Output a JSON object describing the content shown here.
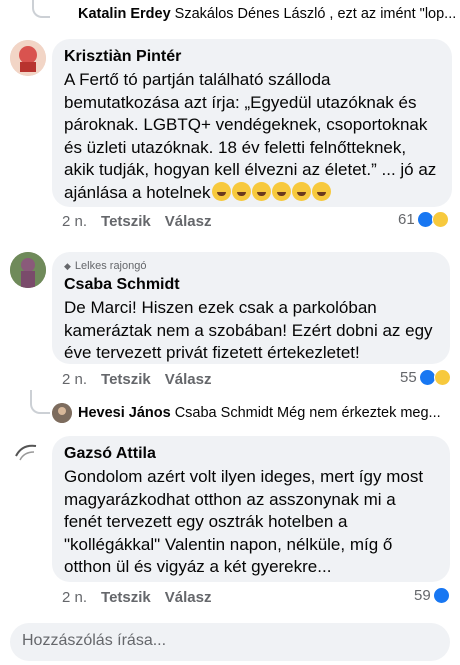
{
  "top_reply": {
    "author": "Katalin Erdey",
    "preview": "Szakálos Dénes László , ezt az imént \"lop..."
  },
  "comments": [
    {
      "author": "Krisztiàn Pintér",
      "text_before_emoji": "A Fertő tó partján található szálloda bemutatkozása azt írja: „Egyedül utazóknak és pároknak. LGBTQ+ vendégeknek, csoportoknak és üzleti utazóknak. 18 év feletti felnőtteknek, akik tudják, hogyan kell élvezni az életet.” ... jó az ajánlása a hotelnek",
      "emoji_count": 6,
      "time": "2 n.",
      "like_label": "Tetszik",
      "reply_label": "Válasz",
      "reaction_count": "61",
      "reaction_icons": [
        "like-icon",
        "haha-icon"
      ]
    },
    {
      "badge": "Lelkes rajongó",
      "author": "Csaba Schmidt",
      "text": "De Marci! Hiszen ezek csak a parkolóban kameráztak nem a szobában! Ezért dobni az egy éve tervezett privát fizetett értekezletet!",
      "time": "2 n.",
      "like_label": "Tetszik",
      "reply_label": "Válasz",
      "reaction_count": "55",
      "reaction_icons": [
        "like-icon",
        "haha-icon"
      ]
    },
    {
      "author": "Gazsó Attila",
      "text": "Gondolom azért volt ilyen ideges, mert így most magyarázkodhat otthon az asszonynak mi a fenét tervezett egy osztrák hotelben a \"kollégákkal\" Valentin napon, nélküle, míg ő otthon ül és vigyáz a két gyerekre...",
      "time": "2 n.",
      "like_label": "Tetszik",
      "reply_label": "Válasz",
      "reaction_count": "59",
      "reaction_icons": [
        "like-icon"
      ]
    }
  ],
  "mid_reply": {
    "author": "Hevesi János",
    "preview": "Csaba Schmidt  Még nem érkeztek meg..."
  },
  "composer": {
    "placeholder": "Hozzászólás írása..."
  },
  "colors": {
    "bubble": "#f0f2f5",
    "meta_text": "#65676b",
    "like_blue": "#1877f2",
    "haha_yellow": "#f7c93d"
  }
}
